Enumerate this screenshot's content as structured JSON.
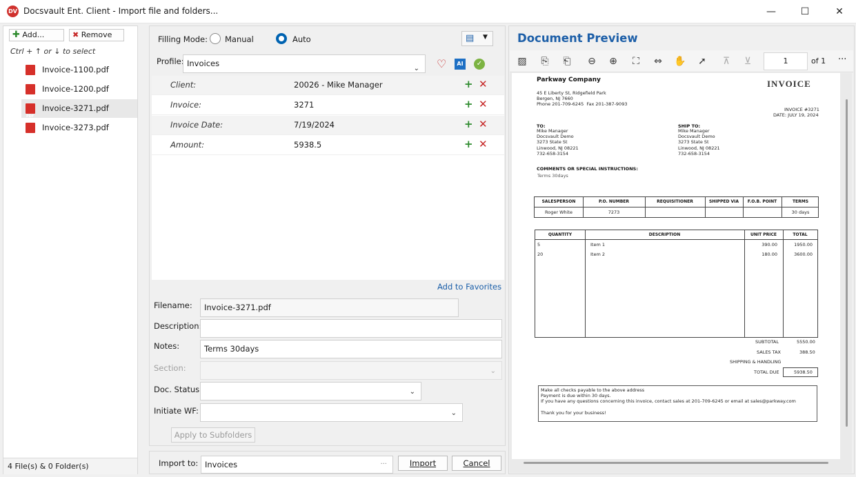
{
  "window": {
    "title": "Docsvault Ent. Client - Import file and folders...",
    "logo": "DV",
    "minimize": "—",
    "maximize": "☐",
    "close": "✕"
  },
  "left": {
    "add_label": "Add...",
    "remove_label": "Remove",
    "hint": "Ctrl + ↑ or ↓ to select",
    "files": [
      "Invoice-1100.pdf",
      "Invoice-1200.pdf",
      "Invoice-3271.pdf",
      "Invoice-3273.pdf"
    ],
    "selected_index": 2,
    "status": "4 File(s) & 0 Folder(s)"
  },
  "form": {
    "filling_mode_label": "Filling Mode:",
    "mode_manual": "Manual",
    "mode_auto": "Auto",
    "selected_mode": "Auto",
    "profile_label": "Profile:",
    "profile_value": "Invoices",
    "indices": [
      {
        "key": "Client:",
        "value": "20026 - Mike Manager"
      },
      {
        "key": "Invoice:",
        "value": "3271"
      },
      {
        "key": "Invoice Date:",
        "value": "7/19/2024"
      },
      {
        "key": "Amount:",
        "value": "5938.5"
      }
    ],
    "add_to_favorites": "Add to Favorites",
    "filename_label": "Filename:",
    "filename_value": "Invoice-3271.pdf",
    "description_label": "Description:",
    "description_value": "",
    "notes_label": "Notes:",
    "notes_value": "Terms 30days",
    "section_label": "Section:",
    "section_value": "",
    "doc_status_label": "Doc. Status:",
    "doc_status_value": "",
    "initiate_wf_label": "Initiate WF:",
    "initiate_wf_value": "",
    "apply_subfolders": "Apply to Subfolders",
    "import_to_label": "Import to:",
    "import_to_value": "Invoices",
    "browse_label": "···",
    "import_button": "Import",
    "cancel_button": "Cancel"
  },
  "preview": {
    "title": "Document Preview",
    "page_current": "1",
    "page_total": "of 1",
    "more": "···"
  },
  "invoice": {
    "company": "Parkway Company",
    "heading": "INVOICE",
    "company_address": "45 E Liberty St, Ridgefield Park\nBergen, NJ 7660\nPhone 201-709-6245  Fax 201-387-9093",
    "invoice_no": "INVOICE #3271",
    "date": "DATE: JULY 19, 2024",
    "to_label": "TO:",
    "to_address": "Mike Manager\nDocsvault Demo\n3273 State St\nLinwood, NJ 08221\n732-658-3154",
    "ship_label": "SHIP TO:",
    "ship_address": "Mike Manager\nDocsvault Demo\n3273 State St\nLinwood, NJ 08221\n732-658-3154",
    "comments_label": "COMMENTS OR SPECIAL INSTRUCTIONS:",
    "comments": "Terms 30days",
    "sales_headers": [
      "SALESPERSON",
      "P.O. NUMBER",
      "REQUISITIONER",
      "SHIPPED VIA",
      "F.O.B. POINT",
      "TERMS"
    ],
    "sales_values": [
      "Roger White",
      "7273",
      "",
      "",
      "",
      "30 days"
    ],
    "item_headers": [
      "QUANTITY",
      "DESCRIPTION",
      "UNIT PRICE",
      "TOTAL"
    ],
    "items": [
      {
        "qty": "5",
        "desc": "Item 1",
        "price": "390.00",
        "total": "1950.00"
      },
      {
        "qty": "20",
        "desc": "Item 2",
        "price": "180.00",
        "total": "3600.00"
      }
    ],
    "subtotal_label": "SUBTOTAL",
    "subtotal": "5550.00",
    "tax_label": "SALES TAX",
    "tax": "388.50",
    "shipping_label": "SHIPPING & HANDLING",
    "shipping": "",
    "total_label": "TOTAL DUE",
    "total": "5938.50",
    "footer": "Make all checks payable to the above address\nPayment is due within 30 days.\nIf you have any questions concerning this invoice, contact sales at 201-709-6245 or email at sales@parkway.com\n\nThank you for your business!"
  },
  "colors": {
    "accent": "#0063b1",
    "preview_title": "#1d5fa8",
    "add_green": "#2e8b2e",
    "remove_red": "#c62828"
  }
}
